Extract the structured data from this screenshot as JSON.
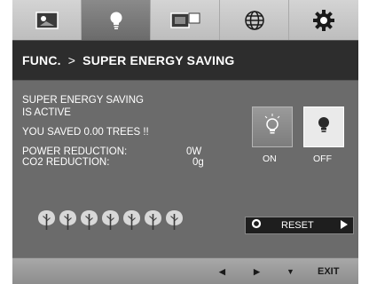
{
  "tabs": [
    {
      "icon": "picture-icon"
    },
    {
      "icon": "lightbulb-icon",
      "active": true
    },
    {
      "icon": "multi-window-icon"
    },
    {
      "icon": "globe-icon"
    },
    {
      "icon": "gear-icon"
    }
  ],
  "title": {
    "section": "FUNC.",
    "separator": ">",
    "page": "SUPER ENERGY SAVING"
  },
  "status": {
    "line1": "SUPER ENERGY SAVING",
    "line2": "IS ACTIVE",
    "saved": "YOU SAVED  0.00 TREES !!",
    "power_label": "POWER REDUCTION:",
    "power_value": "0W",
    "co2_label": "CO2 REDUCTION:",
    "co2_value": "0g"
  },
  "options": {
    "on_label": "ON",
    "off_label": "OFF",
    "selected": "ON"
  },
  "trees_count": 7,
  "reset": {
    "label": "RESET"
  },
  "bottom": {
    "left": "◀",
    "right": "▶",
    "down": "▼",
    "exit": "EXIT"
  },
  "colors": {
    "panel": "#6b6b6b",
    "titlebar": "#2d2d2d",
    "tabs": "#c9c9c9"
  }
}
